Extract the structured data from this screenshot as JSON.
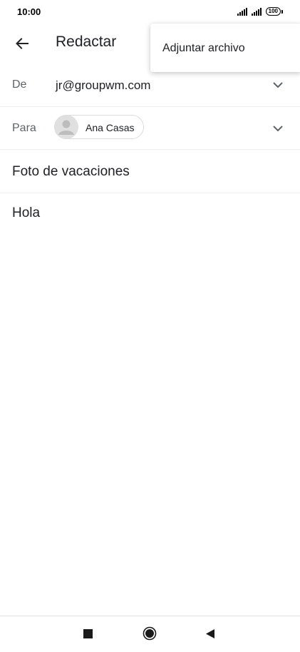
{
  "status_bar": {
    "time": "10:00",
    "battery": "100"
  },
  "app_bar": {
    "title": "Redactar",
    "back_icon": "arrow-back-icon"
  },
  "overflow_menu": {
    "items": [
      {
        "label": "Adjuntar archivo"
      }
    ]
  },
  "compose": {
    "from": {
      "label": "De",
      "value": "jr@groupwm.com"
    },
    "to": {
      "label": "Para",
      "recipients": [
        {
          "name": "Ana Casas",
          "avatar_icon": "person-icon"
        }
      ]
    },
    "subject": "Foto de vacaciones",
    "body": "Hola"
  },
  "nav_bar": {
    "recent_icon": "square-icon",
    "home_icon": "circle-icon",
    "back_icon": "triangle-back-icon"
  },
  "colors": {
    "text_primary": "#202124",
    "text_secondary": "#5f6368",
    "divider": "#eeeeee",
    "chip_border": "#dadce0"
  }
}
